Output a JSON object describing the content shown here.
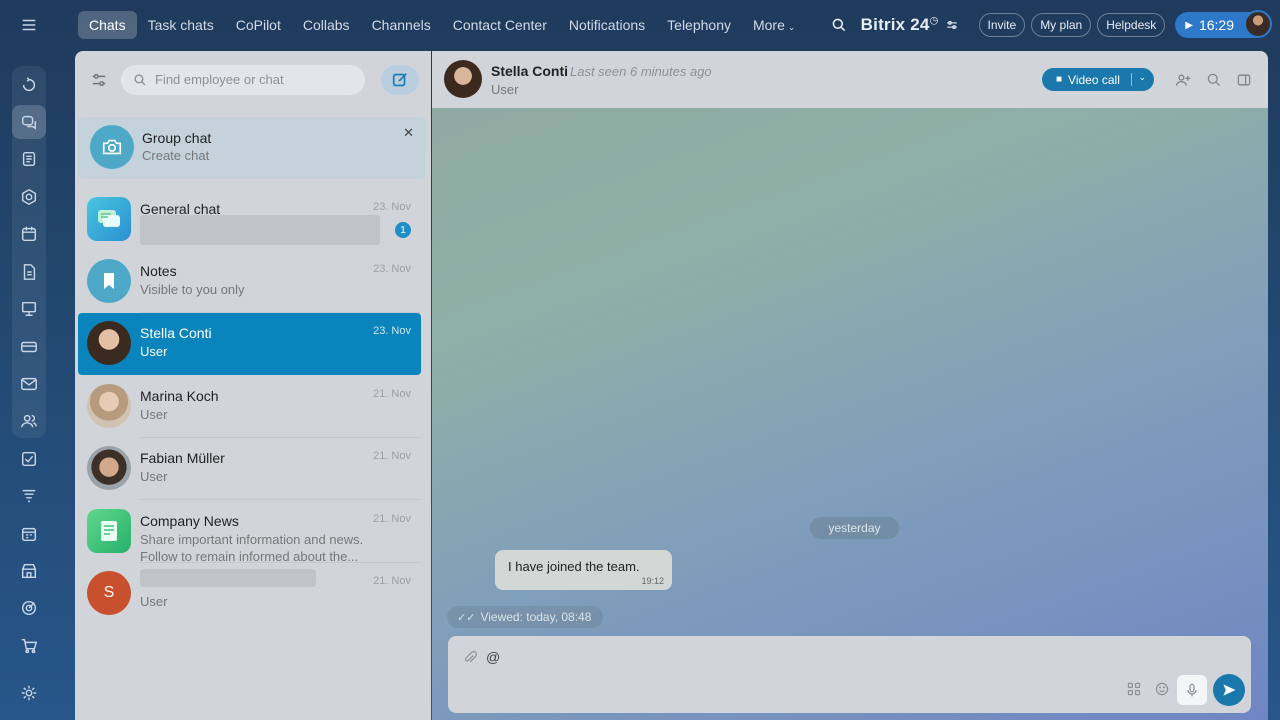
{
  "topnav": {
    "items": [
      {
        "label": "Chats"
      },
      {
        "label": "Task chats"
      },
      {
        "label": "CoPilot"
      },
      {
        "label": "Collabs"
      },
      {
        "label": "Channels"
      },
      {
        "label": "Contact Center"
      },
      {
        "label": "Notifications"
      },
      {
        "label": "Telephony"
      },
      {
        "label": "More"
      }
    ],
    "brand": "Bitrix 24",
    "invite": "Invite",
    "my_plan": "My plan",
    "helpdesk": "Helpdesk",
    "time": "16:29"
  },
  "chat_list": {
    "search_placeholder": "Find employee or chat",
    "group_chat": {
      "title": "Group chat",
      "subtitle": "Create chat"
    },
    "items": [
      {
        "name": "General chat",
        "subtitle": "",
        "date": "23. Nov",
        "badge": "1"
      },
      {
        "name": "Notes",
        "subtitle": "Visible to you only",
        "date": "23. Nov"
      },
      {
        "name": "Stella Conti",
        "subtitle": "User",
        "date": "23. Nov"
      },
      {
        "name": "Marina Koch",
        "subtitle": "User",
        "date": "21. Nov"
      },
      {
        "name": "Fabian Müller",
        "subtitle": "User",
        "date": "21. Nov"
      },
      {
        "name": "Company News",
        "subtitle": "Share important information and news.",
        "subtitle2": "Follow to remain informed about the...",
        "date": "21. Nov"
      },
      {
        "name": "",
        "initial": "S",
        "subtitle": "User",
        "date": "21. Nov"
      }
    ]
  },
  "conversation": {
    "name": "Stella Conti",
    "last_seen": "Last seen 6 minutes ago",
    "role": "User",
    "video_call": "Video call",
    "day_divider": "yesterday",
    "messages": [
      {
        "text": "I have joined the team.",
        "time": "19:12"
      }
    ],
    "viewed": "Viewed: today, 08:48",
    "composer_text": "@"
  },
  "colors": {
    "accent": "#0a84bd",
    "send": "#1a78ad",
    "badge": "#1e8fc7"
  }
}
